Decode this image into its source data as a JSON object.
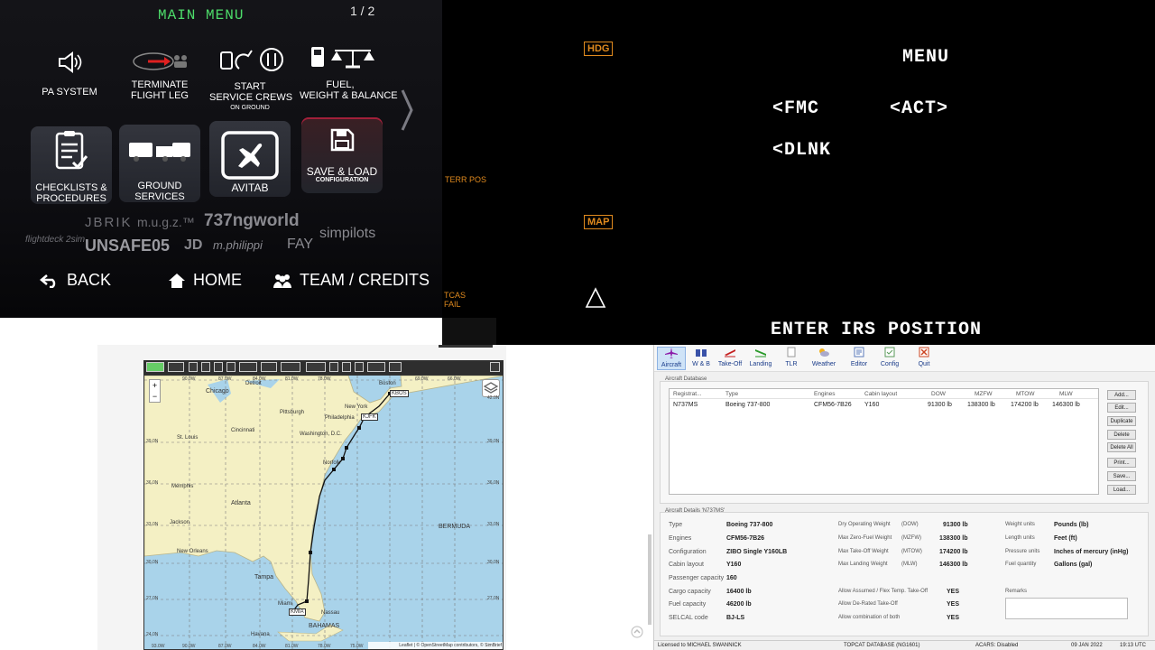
{
  "efb": {
    "title": "MAIN MENU",
    "page": "1 / 2",
    "tiles": [
      {
        "label": "PA SYSTEM",
        "sub": ""
      },
      {
        "label": "TERMINATE\nFLIGHT LEG",
        "sub": ""
      },
      {
        "label": "START\nSERVICE CREWS",
        "sub": "ON GROUND"
      },
      {
        "label": "FUEL,\nWEIGHT & BALANCE",
        "sub": ""
      },
      {
        "label": "CHECKLISTS &\nPROCEDURES",
        "sub": ""
      },
      {
        "label": "GROUND\nSERVICES",
        "sub": ""
      },
      {
        "label": "AVITAB",
        "sub": ""
      },
      {
        "label": "SAVE & LOAD",
        "sub": "CONFIGURATION"
      }
    ],
    "logos": [
      "flightdeck 2sim",
      "JBRIK",
      "m.u.g.z.™",
      "737ngworld",
      "simpilots",
      "UNSAFE05",
      "JD",
      "m.philippi",
      "FAY"
    ],
    "nav": {
      "back": "BACK",
      "home": "HOME",
      "team": "TEAM / CREDITS"
    }
  },
  "cdu": {
    "hdg": "HDG",
    "map": "MAP",
    "terr": "TERR POS",
    "tcas": "TCAS\nFAIL",
    "title": "MENU",
    "fmc": "<FMC",
    "act": "<ACT>",
    "dlnk": "<DLNK",
    "scratch": "ENTER IRS POSITION"
  },
  "map": {
    "cities": [
      "Chicago",
      "Detroit",
      "Pittsburgh",
      "New York",
      "Boston",
      "Philadelphia",
      "Washington, D.C.",
      "Cincinnati",
      "St. Louis",
      "Norfolk",
      "Memphis",
      "Atlanta",
      "Jackson",
      "New Orleans",
      "Tampa",
      "Miami",
      "Havana",
      "BAHAMAS",
      "BERMUDA",
      "Nassau"
    ],
    "waypoints": [
      "KBOS",
      "KJFK",
      "KMIA"
    ],
    "lat_labels": [
      "42.0N",
      "39.0N",
      "36.0N",
      "33.0N",
      "30.0N",
      "27.0N",
      "24.0N"
    ],
    "lon_labels": [
      "93.0W",
      "90.0W",
      "87.0W",
      "84.0W",
      "81.0W",
      "78.0W",
      "75.0W",
      "72.0W",
      "69.0W",
      "66.0W"
    ],
    "attribution": "Leaflet | © OpenStreetMap contributors, © SimBrief",
    "zoom_in": "+",
    "zoom_out": "−"
  },
  "topcat": {
    "toolbar": [
      "Aircraft",
      "W & B",
      "Take-Off",
      "Landing",
      "TLR",
      "Weather",
      "Editor",
      "Config",
      "Quit"
    ],
    "db_title": "Aircraft Database",
    "columns": [
      "Registrat...",
      "Type",
      "Engines",
      "Cabin layout",
      "DOW",
      "MZFW",
      "MTOW",
      "MLW"
    ],
    "row": [
      "N737MS",
      "Boeing 737-800",
      "CFM56-7B26",
      "Y160",
      "91300 lb",
      "138300 lb",
      "174200 lb",
      "146300 lb"
    ],
    "buttons": [
      "Add...",
      "Edit...",
      "Duplicate",
      "Delete",
      "Delete All",
      "Print...",
      "Save...",
      "Load..."
    ],
    "details_title": "Aircraft Details 'N737MS'",
    "details_left": [
      [
        "Type",
        "Boeing 737-800"
      ],
      [
        "Engines",
        "CFM56-7B26"
      ],
      [
        "Configuration",
        "ZIBO Single Y160LB"
      ],
      [
        "Cabin layout",
        "Y160"
      ],
      [
        "Passenger capacity",
        "160"
      ],
      [
        "Cargo capacity",
        "16400 lb"
      ],
      [
        "Fuel capacity",
        "46200 lb"
      ],
      [
        "SELCAL code",
        "BJ-LS"
      ]
    ],
    "details_mid": [
      [
        "Dry Operating Weight",
        "(DOW)",
        "91300 lb"
      ],
      [
        "Max Zero-Fuel Weight",
        "(MZFW)",
        "138300 lb"
      ],
      [
        "Max Take-Off Weight",
        "(MTOW)",
        "174200 lb"
      ],
      [
        "Max Landing Weight",
        "(MLW)",
        "146300 lb"
      ]
    ],
    "details_flags": [
      [
        "Allow Assumed / Flex Temp. Take-Off",
        "YES"
      ],
      [
        "Allow De-Rated Take-Off",
        "YES"
      ],
      [
        "Allow combination of both",
        "YES"
      ]
    ],
    "details_units": [
      [
        "Weight units",
        "Pounds (lb)"
      ],
      [
        "Length units",
        "Feet (ft)"
      ],
      [
        "Pressure units",
        "Inches of mercury (inHg)"
      ],
      [
        "Fuel quantity",
        "Gallons (gal)"
      ]
    ],
    "remarks": "Remarks",
    "status": {
      "license": "Licensed to MICHAEL SWANNICK",
      "db": "TOPCAT DATABASE (NG1601)",
      "acars": "ACARS: Disabled",
      "date": "09 JAN 2022",
      "time": "19:13 UTC"
    }
  },
  "colors": {
    "efb_green": "#4ddc6a",
    "cdu_amber": "#e08a1e",
    "route": "#111111",
    "land": "#f4f0c4",
    "water": "#a9d3ea"
  }
}
